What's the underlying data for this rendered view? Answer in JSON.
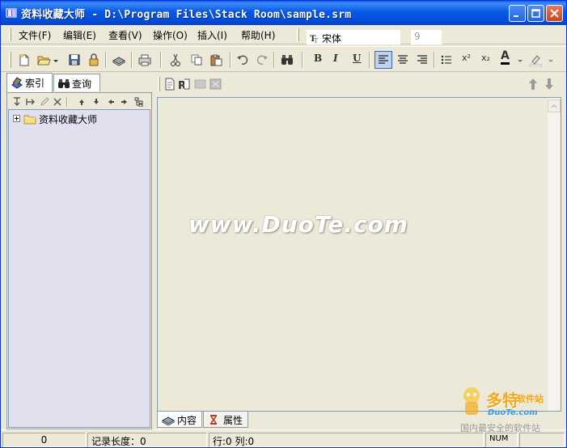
{
  "window": {
    "title": "资料收藏大师 - D:\\Program Files\\Stack Room\\sample.srm"
  },
  "menu": {
    "items": [
      "文件(F)",
      "编辑(E)",
      "查看(V)",
      "操作(O)",
      "插入(I)",
      "帮助(H)"
    ]
  },
  "format": {
    "font_name": "宋体",
    "font_size": "9"
  },
  "toolbar": {
    "bold": "B",
    "italic": "I",
    "underline": "U",
    "superscript": "x²",
    "subscript": "x₂",
    "font_color": "A"
  },
  "left_tabs": {
    "index_label": "索引",
    "search_label": "查询"
  },
  "tree": {
    "root_label": "资料收藏大师"
  },
  "editor": {
    "watermark": "www.DuoTe.com"
  },
  "bottom_tabs": {
    "content_label": "内容",
    "attributes_label": "属性"
  },
  "status": {
    "count": "0",
    "record_length": "记录长度：0",
    "row_col": "行:0   列:0",
    "num": "NUM"
  },
  "corner_logo": {
    "title": "多特",
    "subtitle": "软件站",
    "brand": "DuoTe.com",
    "slogan": "国内最安全的软件站"
  },
  "colors": {
    "title_bar": "#0758e6",
    "chrome": "#ece9d8",
    "tree_bg": "#e0e0ee",
    "accent": "#316ac5"
  }
}
